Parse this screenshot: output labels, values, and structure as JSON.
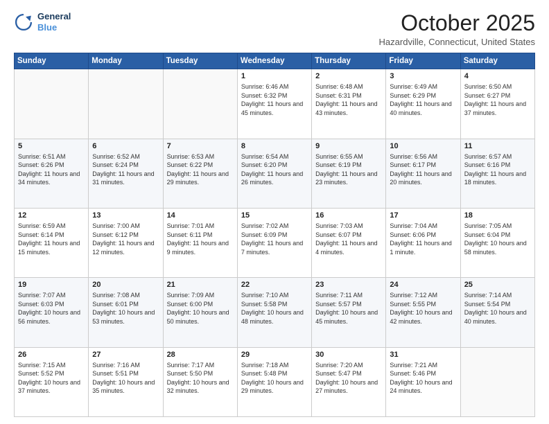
{
  "header": {
    "logo_line1": "General",
    "logo_line2": "Blue",
    "month": "October 2025",
    "location": "Hazardville, Connecticut, United States"
  },
  "weekdays": [
    "Sunday",
    "Monday",
    "Tuesday",
    "Wednesday",
    "Thursday",
    "Friday",
    "Saturday"
  ],
  "weeks": [
    [
      {
        "day": "",
        "info": ""
      },
      {
        "day": "",
        "info": ""
      },
      {
        "day": "",
        "info": ""
      },
      {
        "day": "1",
        "info": "Sunrise: 6:46 AM\nSunset: 6:32 PM\nDaylight: 11 hours\nand 45 minutes."
      },
      {
        "day": "2",
        "info": "Sunrise: 6:48 AM\nSunset: 6:31 PM\nDaylight: 11 hours\nand 43 minutes."
      },
      {
        "day": "3",
        "info": "Sunrise: 6:49 AM\nSunset: 6:29 PM\nDaylight: 11 hours\nand 40 minutes."
      },
      {
        "day": "4",
        "info": "Sunrise: 6:50 AM\nSunset: 6:27 PM\nDaylight: 11 hours\nand 37 minutes."
      }
    ],
    [
      {
        "day": "5",
        "info": "Sunrise: 6:51 AM\nSunset: 6:26 PM\nDaylight: 11 hours\nand 34 minutes."
      },
      {
        "day": "6",
        "info": "Sunrise: 6:52 AM\nSunset: 6:24 PM\nDaylight: 11 hours\nand 31 minutes."
      },
      {
        "day": "7",
        "info": "Sunrise: 6:53 AM\nSunset: 6:22 PM\nDaylight: 11 hours\nand 29 minutes."
      },
      {
        "day": "8",
        "info": "Sunrise: 6:54 AM\nSunset: 6:20 PM\nDaylight: 11 hours\nand 26 minutes."
      },
      {
        "day": "9",
        "info": "Sunrise: 6:55 AM\nSunset: 6:19 PM\nDaylight: 11 hours\nand 23 minutes."
      },
      {
        "day": "10",
        "info": "Sunrise: 6:56 AM\nSunset: 6:17 PM\nDaylight: 11 hours\nand 20 minutes."
      },
      {
        "day": "11",
        "info": "Sunrise: 6:57 AM\nSunset: 6:16 PM\nDaylight: 11 hours\nand 18 minutes."
      }
    ],
    [
      {
        "day": "12",
        "info": "Sunrise: 6:59 AM\nSunset: 6:14 PM\nDaylight: 11 hours\nand 15 minutes."
      },
      {
        "day": "13",
        "info": "Sunrise: 7:00 AM\nSunset: 6:12 PM\nDaylight: 11 hours\nand 12 minutes."
      },
      {
        "day": "14",
        "info": "Sunrise: 7:01 AM\nSunset: 6:11 PM\nDaylight: 11 hours\nand 9 minutes."
      },
      {
        "day": "15",
        "info": "Sunrise: 7:02 AM\nSunset: 6:09 PM\nDaylight: 11 hours\nand 7 minutes."
      },
      {
        "day": "16",
        "info": "Sunrise: 7:03 AM\nSunset: 6:07 PM\nDaylight: 11 hours\nand 4 minutes."
      },
      {
        "day": "17",
        "info": "Sunrise: 7:04 AM\nSunset: 6:06 PM\nDaylight: 11 hours\nand 1 minute."
      },
      {
        "day": "18",
        "info": "Sunrise: 7:05 AM\nSunset: 6:04 PM\nDaylight: 10 hours\nand 58 minutes."
      }
    ],
    [
      {
        "day": "19",
        "info": "Sunrise: 7:07 AM\nSunset: 6:03 PM\nDaylight: 10 hours\nand 56 minutes."
      },
      {
        "day": "20",
        "info": "Sunrise: 7:08 AM\nSunset: 6:01 PM\nDaylight: 10 hours\nand 53 minutes."
      },
      {
        "day": "21",
        "info": "Sunrise: 7:09 AM\nSunset: 6:00 PM\nDaylight: 10 hours\nand 50 minutes."
      },
      {
        "day": "22",
        "info": "Sunrise: 7:10 AM\nSunset: 5:58 PM\nDaylight: 10 hours\nand 48 minutes."
      },
      {
        "day": "23",
        "info": "Sunrise: 7:11 AM\nSunset: 5:57 PM\nDaylight: 10 hours\nand 45 minutes."
      },
      {
        "day": "24",
        "info": "Sunrise: 7:12 AM\nSunset: 5:55 PM\nDaylight: 10 hours\nand 42 minutes."
      },
      {
        "day": "25",
        "info": "Sunrise: 7:14 AM\nSunset: 5:54 PM\nDaylight: 10 hours\nand 40 minutes."
      }
    ],
    [
      {
        "day": "26",
        "info": "Sunrise: 7:15 AM\nSunset: 5:52 PM\nDaylight: 10 hours\nand 37 minutes."
      },
      {
        "day": "27",
        "info": "Sunrise: 7:16 AM\nSunset: 5:51 PM\nDaylight: 10 hours\nand 35 minutes."
      },
      {
        "day": "28",
        "info": "Sunrise: 7:17 AM\nSunset: 5:50 PM\nDaylight: 10 hours\nand 32 minutes."
      },
      {
        "day": "29",
        "info": "Sunrise: 7:18 AM\nSunset: 5:48 PM\nDaylight: 10 hours\nand 29 minutes."
      },
      {
        "day": "30",
        "info": "Sunrise: 7:20 AM\nSunset: 5:47 PM\nDaylight: 10 hours\nand 27 minutes."
      },
      {
        "day": "31",
        "info": "Sunrise: 7:21 AM\nSunset: 5:46 PM\nDaylight: 10 hours\nand 24 minutes."
      },
      {
        "day": "",
        "info": ""
      }
    ]
  ]
}
